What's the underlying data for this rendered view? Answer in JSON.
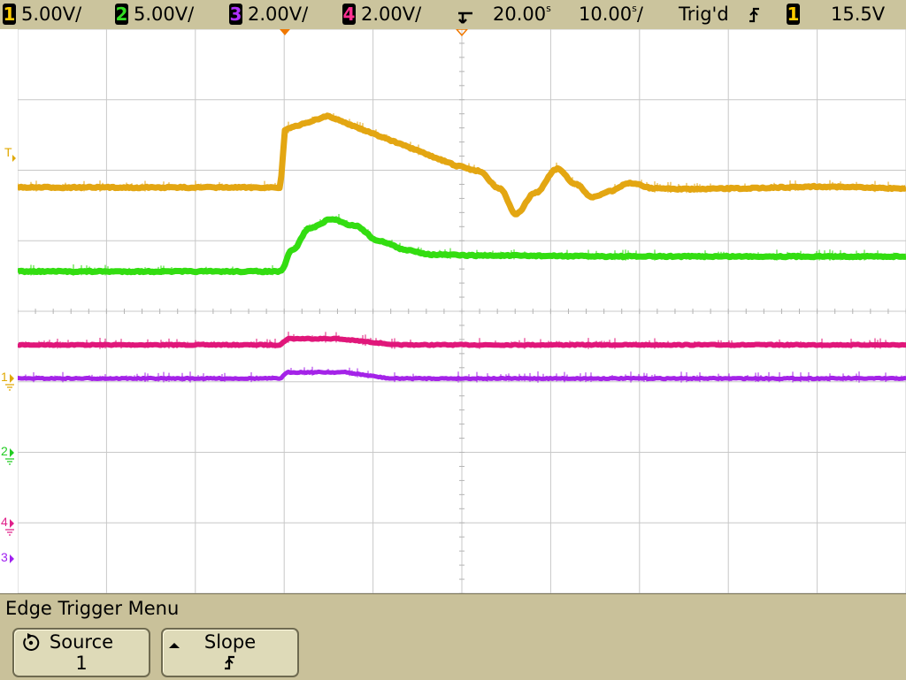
{
  "status_bar": {
    "channels": [
      {
        "num": "1",
        "scale": "5.00V/",
        "color": "#ffcc00"
      },
      {
        "num": "2",
        "scale": "5.00V/",
        "color": "#33dd22"
      },
      {
        "num": "3",
        "scale": "2.00V/",
        "color": "#b030ff"
      },
      {
        "num": "4",
        "scale": "2.00V/",
        "color": "#ff3090"
      }
    ],
    "delay": "20.00",
    "delay_unit": "s",
    "timebase": "10.00",
    "timebase_unit": "s/",
    "trigger_status": "Trig'd",
    "trigger_slope_symbol": "⨍",
    "trigger_source": "1",
    "trigger_level": "15.5V"
  },
  "left_markers": [
    {
      "label": "T",
      "color": "#e0a800"
    },
    {
      "label": "1",
      "color": "#e0a800"
    },
    {
      "label": "2",
      "color": "#22cc22"
    },
    {
      "label": "4",
      "color": "#e0208a"
    },
    {
      "label": "3",
      "color": "#a020f0"
    }
  ],
  "menu": {
    "title": "Edge Trigger Menu",
    "softkeys": [
      {
        "label": "Source",
        "value": "1",
        "icon": "rotate-knob-icon"
      },
      {
        "label": "Slope",
        "value": "⨍",
        "icon": "up-arrow-icon"
      }
    ]
  },
  "waveform_colors": {
    "ch1": "#e3a612",
    "ch2": "#33dd11",
    "ch3": "#a423e8",
    "ch4": "#e0177a"
  }
}
